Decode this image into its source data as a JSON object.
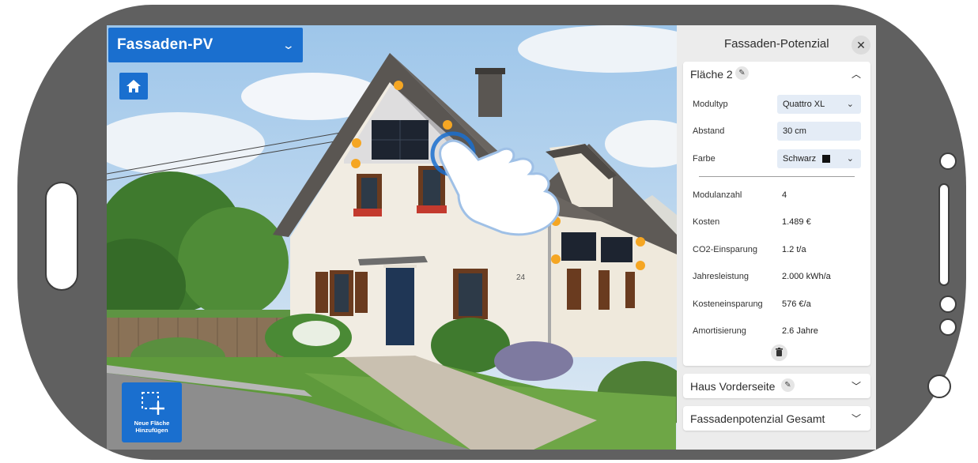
{
  "app": {
    "title": "Fassaden-PV",
    "home_icon": "home-icon",
    "add_button_label_line1": "Neue Fläche",
    "add_button_label_line2": "Hinzufügen",
    "house_number": "24"
  },
  "panel": {
    "title": "Fassaden-Potenzial",
    "sections": [
      {
        "name": "Fläche 2",
        "expanded": true,
        "fields": {
          "modultyp": {
            "label": "Modultyp",
            "value": "Quattro XL"
          },
          "abstand": {
            "label": "Abstand",
            "value": "30 cm"
          },
          "farbe": {
            "label": "Farbe",
            "value": "Schwarz",
            "swatch_color": "#111111"
          }
        },
        "stats": [
          {
            "label": "Modulanzahl",
            "value": "4"
          },
          {
            "label": "Kosten",
            "value": "1.489 €"
          },
          {
            "label": "CO2-Einsparung",
            "value": "1.2 t/a"
          },
          {
            "label": "Jahresleistung",
            "value": "2.000 kWh/a"
          },
          {
            "label": "Kosteneinsparung",
            "value": "576 €/a"
          },
          {
            "label": "Amortisierung",
            "value": "2.6 Jahre"
          }
        ]
      },
      {
        "name": "Haus Vorderseite",
        "expanded": false
      },
      {
        "name": "Fassadenpotenzial Gesamt",
        "expanded": false
      }
    ]
  },
  "colors": {
    "accent": "#1a6fcf",
    "handle": "#f5a623",
    "panel_bg": "#ececec",
    "field_bg": "#e4ecf6"
  }
}
